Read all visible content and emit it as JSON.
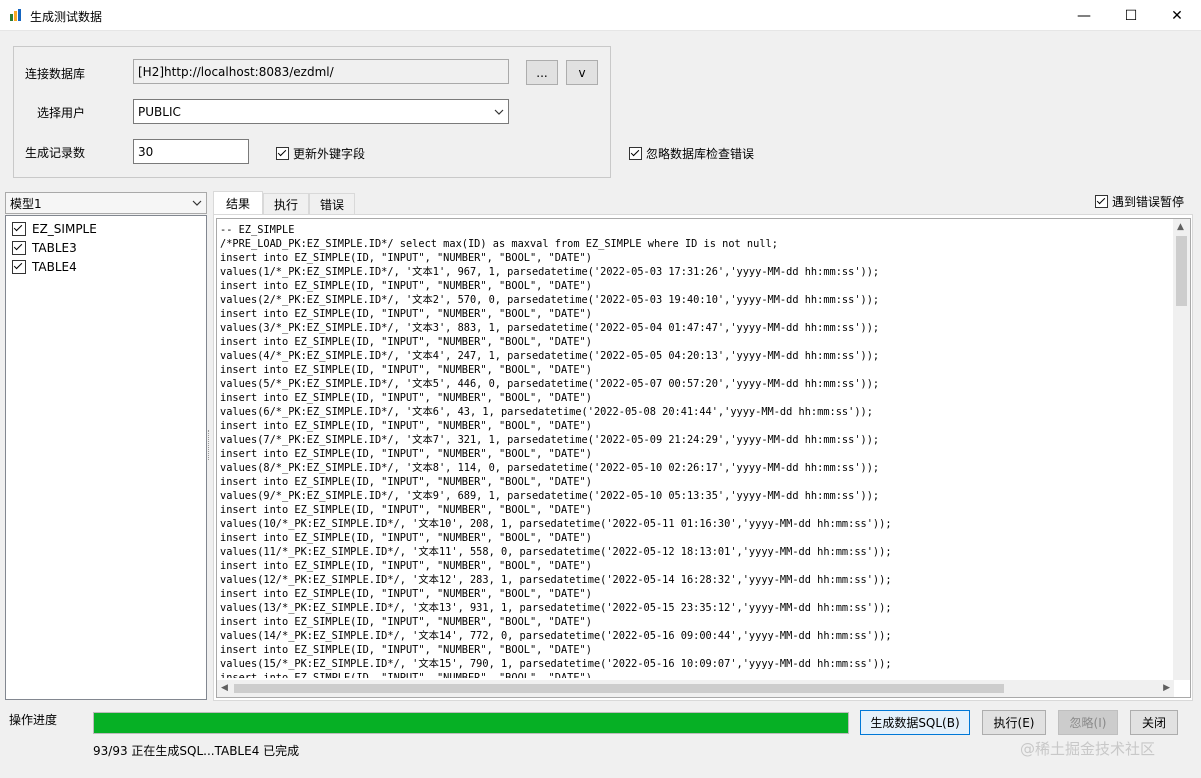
{
  "window": {
    "title": "生成测试数据",
    "minimize_icon": "—",
    "maximize_icon": "☐",
    "close_icon": "✕"
  },
  "connection": {
    "db_label": "连接数据库",
    "db_value": "[H2]http://localhost:8083/ezdml/",
    "browse_label": "...",
    "history_label": "v",
    "user_label": "选择用户",
    "user_value": "PUBLIC",
    "count_label": "生成记录数",
    "count_value": "30",
    "update_fk_label": "更新外键字段",
    "update_fk_checked": true
  },
  "ignore_db_errors_label": "忽略数据库检查错误",
  "pause_on_error_label": "遇到错误暂停",
  "model": {
    "selected": "模型1"
  },
  "tables": [
    {
      "name": "EZ_SIMPLE",
      "checked": true
    },
    {
      "name": "TABLE3",
      "checked": true
    },
    {
      "name": "TABLE4",
      "checked": true
    }
  ],
  "tabs": [
    "结果",
    "执行",
    "错误"
  ],
  "sql_lines": [
    "-- EZ_SIMPLE",
    "/*PRE_LOAD_PK:EZ_SIMPLE.ID*/ select max(ID) as maxval from EZ_SIMPLE where ID is not null;",
    "insert into EZ_SIMPLE(ID, \"INPUT\", \"NUMBER\", \"BOOL\", \"DATE\")",
    "values(1/*_PK:EZ_SIMPLE.ID*/, '文本1', 967, 1, parsedatetime('2022-05-03 17:31:26','yyyy-MM-dd hh:mm:ss'));",
    "insert into EZ_SIMPLE(ID, \"INPUT\", \"NUMBER\", \"BOOL\", \"DATE\")",
    "values(2/*_PK:EZ_SIMPLE.ID*/, '文本2', 570, 0, parsedatetime('2022-05-03 19:40:10','yyyy-MM-dd hh:mm:ss'));",
    "insert into EZ_SIMPLE(ID, \"INPUT\", \"NUMBER\", \"BOOL\", \"DATE\")",
    "values(3/*_PK:EZ_SIMPLE.ID*/, '文本3', 883, 1, parsedatetime('2022-05-04 01:47:47','yyyy-MM-dd hh:mm:ss'));",
    "insert into EZ_SIMPLE(ID, \"INPUT\", \"NUMBER\", \"BOOL\", \"DATE\")",
    "values(4/*_PK:EZ_SIMPLE.ID*/, '文本4', 247, 1, parsedatetime('2022-05-05 04:20:13','yyyy-MM-dd hh:mm:ss'));",
    "insert into EZ_SIMPLE(ID, \"INPUT\", \"NUMBER\", \"BOOL\", \"DATE\")",
    "values(5/*_PK:EZ_SIMPLE.ID*/, '文本5', 446, 0, parsedatetime('2022-05-07 00:57:20','yyyy-MM-dd hh:mm:ss'));",
    "insert into EZ_SIMPLE(ID, \"INPUT\", \"NUMBER\", \"BOOL\", \"DATE\")",
    "values(6/*_PK:EZ_SIMPLE.ID*/, '文本6', 43, 1, parsedatetime('2022-05-08 20:41:44','yyyy-MM-dd hh:mm:ss'));",
    "insert into EZ_SIMPLE(ID, \"INPUT\", \"NUMBER\", \"BOOL\", \"DATE\")",
    "values(7/*_PK:EZ_SIMPLE.ID*/, '文本7', 321, 1, parsedatetime('2022-05-09 21:24:29','yyyy-MM-dd hh:mm:ss'));",
    "insert into EZ_SIMPLE(ID, \"INPUT\", \"NUMBER\", \"BOOL\", \"DATE\")",
    "values(8/*_PK:EZ_SIMPLE.ID*/, '文本8', 114, 0, parsedatetime('2022-05-10 02:26:17','yyyy-MM-dd hh:mm:ss'));",
    "insert into EZ_SIMPLE(ID, \"INPUT\", \"NUMBER\", \"BOOL\", \"DATE\")",
    "values(9/*_PK:EZ_SIMPLE.ID*/, '文本9', 689, 1, parsedatetime('2022-05-10 05:13:35','yyyy-MM-dd hh:mm:ss'));",
    "insert into EZ_SIMPLE(ID, \"INPUT\", \"NUMBER\", \"BOOL\", \"DATE\")",
    "values(10/*_PK:EZ_SIMPLE.ID*/, '文本10', 208, 1, parsedatetime('2022-05-11 01:16:30','yyyy-MM-dd hh:mm:ss'));",
    "insert into EZ_SIMPLE(ID, \"INPUT\", \"NUMBER\", \"BOOL\", \"DATE\")",
    "values(11/*_PK:EZ_SIMPLE.ID*/, '文本11', 558, 0, parsedatetime('2022-05-12 18:13:01','yyyy-MM-dd hh:mm:ss'));",
    "insert into EZ_SIMPLE(ID, \"INPUT\", \"NUMBER\", \"BOOL\", \"DATE\")",
    "values(12/*_PK:EZ_SIMPLE.ID*/, '文本12', 283, 1, parsedatetime('2022-05-14 16:28:32','yyyy-MM-dd hh:mm:ss'));",
    "insert into EZ_SIMPLE(ID, \"INPUT\", \"NUMBER\", \"BOOL\", \"DATE\")",
    "values(13/*_PK:EZ_SIMPLE.ID*/, '文本13', 931, 1, parsedatetime('2022-05-15 23:35:12','yyyy-MM-dd hh:mm:ss'));",
    "insert into EZ_SIMPLE(ID, \"INPUT\", \"NUMBER\", \"BOOL\", \"DATE\")",
    "values(14/*_PK:EZ_SIMPLE.ID*/, '文本14', 772, 0, parsedatetime('2022-05-16 09:00:44','yyyy-MM-dd hh:mm:ss'));",
    "insert into EZ_SIMPLE(ID, \"INPUT\", \"NUMBER\", \"BOOL\", \"DATE\")",
    "values(15/*_PK:EZ_SIMPLE.ID*/, '文本15', 790, 1, parsedatetime('2022-05-16 10:09:07','yyyy-MM-dd hh:mm:ss'));",
    "insert into EZ_SIMPLE(ID, \"INPUT\", \"NUMBER\", \"BOOL\", \"DATE\")"
  ],
  "progress": {
    "label": "操作进度",
    "fraction": 1.0,
    "fill_color": "#06b025",
    "status_text": "93/93 正在生成SQL...TABLE4 已完成"
  },
  "buttons": {
    "generate": "生成数据SQL(B)",
    "execute": "执行(E)",
    "ignore": "忽略(I)",
    "close": "关闭"
  },
  "watermark": "@稀土掘金技术社区"
}
